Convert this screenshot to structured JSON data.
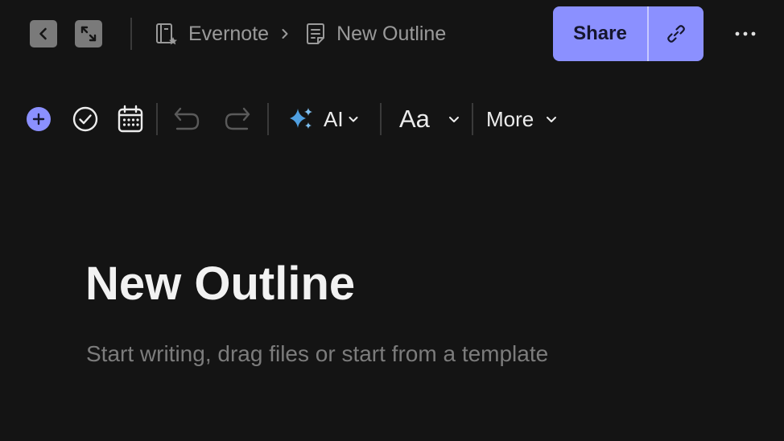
{
  "topbar": {
    "back_icon": "chevron-left-icon",
    "expand_icon": "expand-arrows-icon",
    "breadcrumb": [
      {
        "label": "Evernote",
        "icon": "notebook-star-icon"
      },
      {
        "label": "New Outline",
        "icon": "note-document-icon"
      }
    ],
    "share_label": "Share",
    "share_link_icon": "link-icon",
    "more_icon": "more-horizontal-icon"
  },
  "toolbar": {
    "items": [
      {
        "name": "insert",
        "icon": "plus-circle-icon"
      },
      {
        "name": "task",
        "icon": "check-circle-icon"
      },
      {
        "name": "calendar",
        "icon": "calendar-icon"
      },
      {
        "name": "undo",
        "icon": "undo-icon"
      },
      {
        "name": "redo",
        "icon": "redo-icon"
      }
    ],
    "ai_label": "AI",
    "format_label": "Aa",
    "more_label": "More"
  },
  "editor": {
    "title": "New Outline",
    "placeholder": "Start writing, drag files or start from a template"
  },
  "colors": {
    "background": "#141414",
    "accent": "#8b90ff",
    "ai_sparkle": "#4f9fe0"
  }
}
